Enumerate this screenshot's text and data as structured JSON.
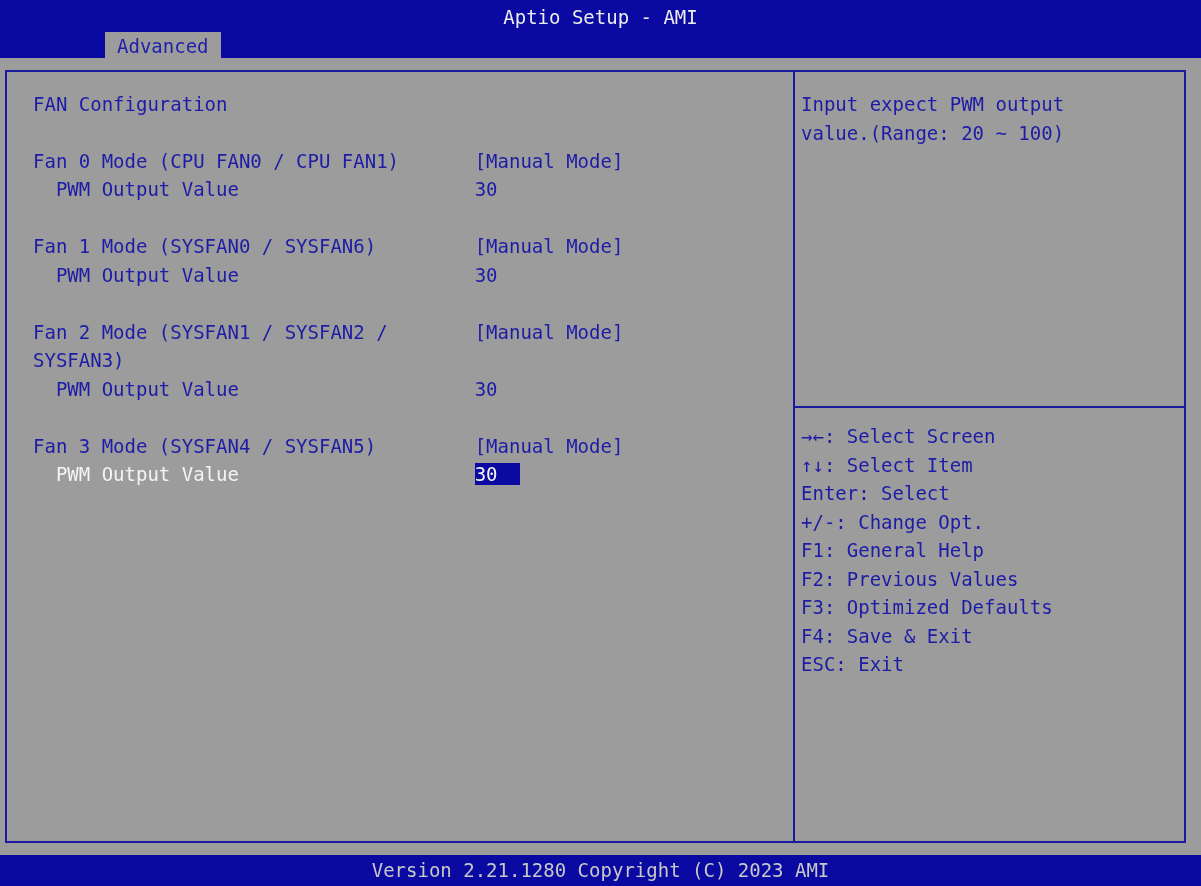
{
  "window": {
    "title": "Aptio Setup - AMI"
  },
  "tabs": [
    {
      "label": "Advanced",
      "selected": true
    }
  ],
  "section_title": "FAN Configuration",
  "groups": [
    {
      "items": [
        {
          "kind": "setting",
          "label": "Fan 0 Mode (CPU FAN0 / CPU FAN1)",
          "value": "[Manual Mode]",
          "selected": false
        },
        {
          "kind": "subitem",
          "label": "PWM Output Value",
          "value": "30",
          "selected": false
        }
      ]
    },
    {
      "items": [
        {
          "kind": "setting",
          "label": "Fan 1 Mode (SYSFAN0 / SYSFAN6)",
          "value": "[Manual Mode]",
          "selected": false
        },
        {
          "kind": "subitem",
          "label": "PWM Output Value",
          "value": "30",
          "selected": false
        }
      ]
    },
    {
      "items": [
        {
          "kind": "setting",
          "label": "Fan 2 Mode (SYSFAN1 / SYSFAN2 / SYSFAN3)",
          "value": "[Manual Mode]",
          "selected": false
        },
        {
          "kind": "subitem",
          "label": "PWM Output Value",
          "value": "30",
          "selected": false
        }
      ]
    },
    {
      "items": [
        {
          "kind": "setting",
          "label": "Fan 3 Mode (SYSFAN4 / SYSFAN5)",
          "value": "[Manual Mode]",
          "selected": false
        },
        {
          "kind": "subitem",
          "label": "PWM Output Value",
          "value": "30",
          "selected": true
        }
      ]
    }
  ],
  "help_text": "Input expect PWM output value.(Range: 20 ~ 100)",
  "key_help": [
    "→←: Select Screen",
    "↑↓: Select Item",
    "Enter: Select",
    "+/-: Change Opt.",
    "F1: General Help",
    "F2: Previous Values",
    "F3: Optimized Defaults",
    "F4: Save & Exit",
    "ESC: Exit"
  ],
  "footer": "Version 2.21.1280 Copyright (C) 2023 AMI"
}
